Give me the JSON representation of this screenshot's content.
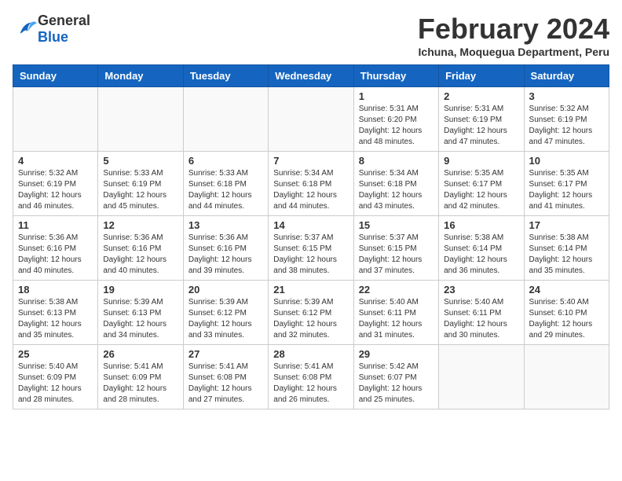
{
  "header": {
    "logo_general": "General",
    "logo_blue": "Blue",
    "month_year": "February 2024",
    "location": "Ichuna, Moquegua Department, Peru"
  },
  "days_of_week": [
    "Sunday",
    "Monday",
    "Tuesday",
    "Wednesday",
    "Thursday",
    "Friday",
    "Saturday"
  ],
  "weeks": [
    [
      {
        "day": "",
        "info": ""
      },
      {
        "day": "",
        "info": ""
      },
      {
        "day": "",
        "info": ""
      },
      {
        "day": "",
        "info": ""
      },
      {
        "day": "1",
        "info": "Sunrise: 5:31 AM\nSunset: 6:20 PM\nDaylight: 12 hours\nand 48 minutes."
      },
      {
        "day": "2",
        "info": "Sunrise: 5:31 AM\nSunset: 6:19 PM\nDaylight: 12 hours\nand 47 minutes."
      },
      {
        "day": "3",
        "info": "Sunrise: 5:32 AM\nSunset: 6:19 PM\nDaylight: 12 hours\nand 47 minutes."
      }
    ],
    [
      {
        "day": "4",
        "info": "Sunrise: 5:32 AM\nSunset: 6:19 PM\nDaylight: 12 hours\nand 46 minutes."
      },
      {
        "day": "5",
        "info": "Sunrise: 5:33 AM\nSunset: 6:19 PM\nDaylight: 12 hours\nand 45 minutes."
      },
      {
        "day": "6",
        "info": "Sunrise: 5:33 AM\nSunset: 6:18 PM\nDaylight: 12 hours\nand 44 minutes."
      },
      {
        "day": "7",
        "info": "Sunrise: 5:34 AM\nSunset: 6:18 PM\nDaylight: 12 hours\nand 44 minutes."
      },
      {
        "day": "8",
        "info": "Sunrise: 5:34 AM\nSunset: 6:18 PM\nDaylight: 12 hours\nand 43 minutes."
      },
      {
        "day": "9",
        "info": "Sunrise: 5:35 AM\nSunset: 6:17 PM\nDaylight: 12 hours\nand 42 minutes."
      },
      {
        "day": "10",
        "info": "Sunrise: 5:35 AM\nSunset: 6:17 PM\nDaylight: 12 hours\nand 41 minutes."
      }
    ],
    [
      {
        "day": "11",
        "info": "Sunrise: 5:36 AM\nSunset: 6:16 PM\nDaylight: 12 hours\nand 40 minutes."
      },
      {
        "day": "12",
        "info": "Sunrise: 5:36 AM\nSunset: 6:16 PM\nDaylight: 12 hours\nand 40 minutes."
      },
      {
        "day": "13",
        "info": "Sunrise: 5:36 AM\nSunset: 6:16 PM\nDaylight: 12 hours\nand 39 minutes."
      },
      {
        "day": "14",
        "info": "Sunrise: 5:37 AM\nSunset: 6:15 PM\nDaylight: 12 hours\nand 38 minutes."
      },
      {
        "day": "15",
        "info": "Sunrise: 5:37 AM\nSunset: 6:15 PM\nDaylight: 12 hours\nand 37 minutes."
      },
      {
        "day": "16",
        "info": "Sunrise: 5:38 AM\nSunset: 6:14 PM\nDaylight: 12 hours\nand 36 minutes."
      },
      {
        "day": "17",
        "info": "Sunrise: 5:38 AM\nSunset: 6:14 PM\nDaylight: 12 hours\nand 35 minutes."
      }
    ],
    [
      {
        "day": "18",
        "info": "Sunrise: 5:38 AM\nSunset: 6:13 PM\nDaylight: 12 hours\nand 35 minutes."
      },
      {
        "day": "19",
        "info": "Sunrise: 5:39 AM\nSunset: 6:13 PM\nDaylight: 12 hours\nand 34 minutes."
      },
      {
        "day": "20",
        "info": "Sunrise: 5:39 AM\nSunset: 6:12 PM\nDaylight: 12 hours\nand 33 minutes."
      },
      {
        "day": "21",
        "info": "Sunrise: 5:39 AM\nSunset: 6:12 PM\nDaylight: 12 hours\nand 32 minutes."
      },
      {
        "day": "22",
        "info": "Sunrise: 5:40 AM\nSunset: 6:11 PM\nDaylight: 12 hours\nand 31 minutes."
      },
      {
        "day": "23",
        "info": "Sunrise: 5:40 AM\nSunset: 6:11 PM\nDaylight: 12 hours\nand 30 minutes."
      },
      {
        "day": "24",
        "info": "Sunrise: 5:40 AM\nSunset: 6:10 PM\nDaylight: 12 hours\nand 29 minutes."
      }
    ],
    [
      {
        "day": "25",
        "info": "Sunrise: 5:40 AM\nSunset: 6:09 PM\nDaylight: 12 hours\nand 28 minutes."
      },
      {
        "day": "26",
        "info": "Sunrise: 5:41 AM\nSunset: 6:09 PM\nDaylight: 12 hours\nand 28 minutes."
      },
      {
        "day": "27",
        "info": "Sunrise: 5:41 AM\nSunset: 6:08 PM\nDaylight: 12 hours\nand 27 minutes."
      },
      {
        "day": "28",
        "info": "Sunrise: 5:41 AM\nSunset: 6:08 PM\nDaylight: 12 hours\nand 26 minutes."
      },
      {
        "day": "29",
        "info": "Sunrise: 5:42 AM\nSunset: 6:07 PM\nDaylight: 12 hours\nand 25 minutes."
      },
      {
        "day": "",
        "info": ""
      },
      {
        "day": "",
        "info": ""
      }
    ]
  ]
}
